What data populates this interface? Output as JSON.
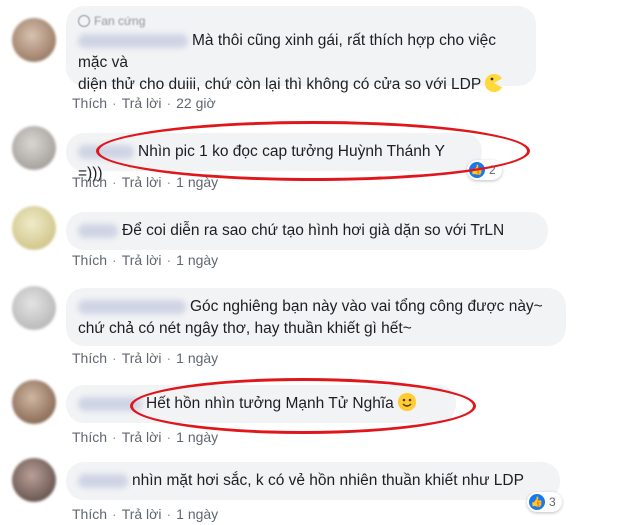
{
  "comments": [
    {
      "badge": "Fan cứng",
      "text_line1": "Mà thôi cũng xinh gái, rất thích hợp cho việc mặc và",
      "text_line2": "diện thử cho duiii, chứ còn lại thì không có cửa so với LDP",
      "like": "Thích",
      "reply": "Trả lời",
      "time": "22 giờ",
      "emoji": "pacman-emoji"
    },
    {
      "text_line1": "Nhìn pic 1 ko đọc cap tưởng Huỳnh Thánh Y =)))",
      "like": "Thích",
      "reply": "Trả lời",
      "time": "1 ngày",
      "reactions": "2"
    },
    {
      "text_line1": "Để coi diễn ra sao chứ tạo hình hơi già dặn so với TrLN",
      "like": "Thích",
      "reply": "Trả lời",
      "time": "1 ngày"
    },
    {
      "text_line1": "Góc nghiêng bạn này vào vai tổng công được này~",
      "text_line2": "chứ chả có nét ngây thơ, hay thuần khiết gì hết~",
      "like": "Thích",
      "reply": "Trả lời",
      "time": "1 ngày"
    },
    {
      "text_line1": "Hết hồn nhìn tưởng Mạnh Tử Nghĩa",
      "like": "Thích",
      "reply": "Trả lời",
      "time": "1 ngày",
      "emoji": "smiling-emoji"
    },
    {
      "text_line1": "nhìn mặt hơi sắc, k có vẻ hồn nhiên thuần khiết như LDP",
      "like": "Thích",
      "reply": "Trả lời",
      "time": "1 ngày",
      "reactions": "3"
    }
  ],
  "colors": {
    "highlight_ring": "#e0161b",
    "bubble_bg": "#f2f3f5",
    "action_text": "#606770",
    "like_blue": "#1877f2"
  }
}
